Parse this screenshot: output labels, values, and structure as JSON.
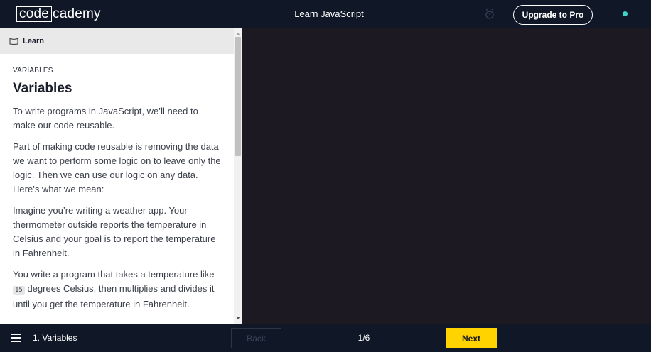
{
  "header": {
    "logo_boxed": "code",
    "logo_rest": "cademy",
    "lesson_title": "Learn JavaScript",
    "upgrade_label": "Upgrade to Pro"
  },
  "learn_panel": {
    "header_label": "Learn",
    "eyebrow": "VARIABLES",
    "heading": "Variables",
    "paragraphs": [
      "To write programs in JavaScript, we’ll need to make our code reusable.",
      "Part of making code reusable is removing the data we want to perform some logic on to leave only the logic. Then we can use our logic on any data. Here’s what we mean:",
      "Imagine you’re writing a weather app. Your thermometer outside reports the temperature in Celsius and your goal is to report the temperature in Fahrenheit."
    ],
    "last_para_start": "You write a program that takes a temperature like",
    "last_para_code": "15",
    "last_para_end": "degrees Celsius, then multiplies and divides it until you get the temperature in Fahrenheit."
  },
  "footer": {
    "lesson_label": "1. Variables",
    "back_label": "Back",
    "progress": "1/6",
    "next_label": "Next"
  },
  "colors": {
    "accent_yellow": "#ffd300",
    "status_teal": "#3bd6c6",
    "bar_navy": "#101827",
    "editor_bg": "#1c1923"
  },
  "icons": {
    "alarm": "alarm-clock-icon",
    "book": "book-icon",
    "menu": "hamburger-menu-icon"
  }
}
